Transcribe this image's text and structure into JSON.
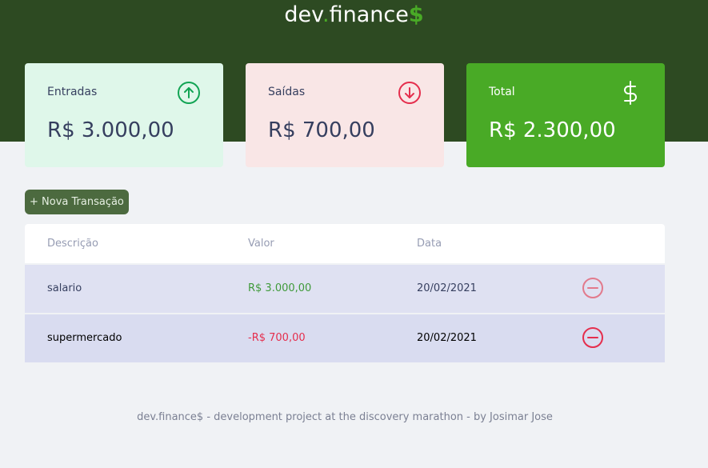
{
  "header": {
    "logo_main": "dev",
    "logo_dot": ".",
    "logo_rest": "finance",
    "logo_currency": "$"
  },
  "summary": {
    "income": {
      "label": "Entradas",
      "amount": "R$ 3.000,00",
      "icon": "arrow-up-circle-icon"
    },
    "expense": {
      "label": "Saídas",
      "amount": "R$ 700,00",
      "icon": "arrow-down-circle-icon"
    },
    "total": {
      "label": "Total",
      "amount": "R$ 2.300,00",
      "icon": "dollar-sign-icon"
    }
  },
  "actions": {
    "new_transaction": "+ Nova Transação"
  },
  "table": {
    "headers": {
      "description": "Descrição",
      "value": "Valor",
      "date": "Data"
    },
    "rows": [
      {
        "description": "salario",
        "value": "R$ 3.000,00",
        "date": "20/02/2021",
        "type": "income"
      },
      {
        "description": "supermercado",
        "value": "-R$ 700,00",
        "date": "20/02/2021",
        "type": "expense"
      }
    ]
  },
  "footer": {
    "text": "dev.finance$ - development project at the discovery marathon - by Josimar Jose"
  },
  "colors": {
    "header_bg": "#2d4a22",
    "accent_green": "#49aa26",
    "expense_red": "#e52e4d",
    "page_bg": "#f0f2f5"
  }
}
